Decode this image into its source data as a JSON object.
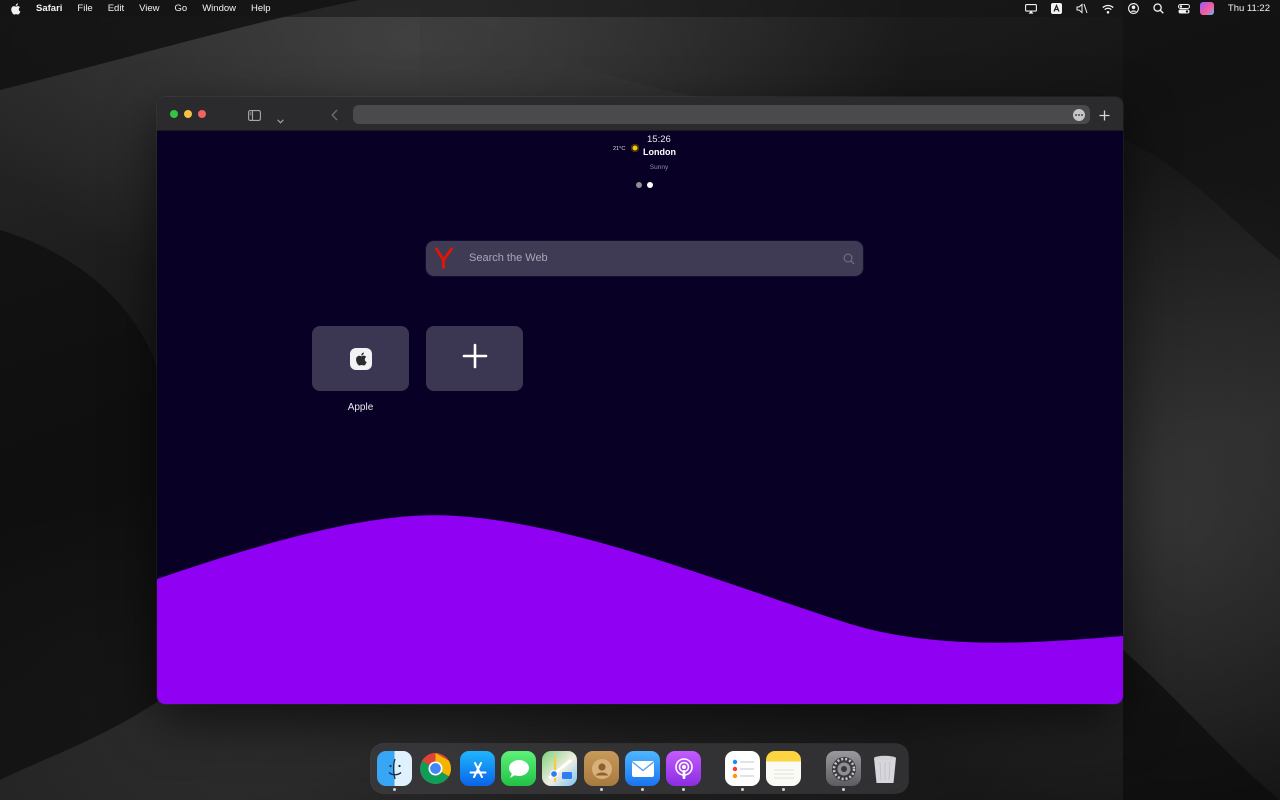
{
  "menubar": {
    "app_name": "Safari",
    "menus": [
      "File",
      "Edit",
      "View",
      "Go",
      "Window",
      "Help"
    ],
    "clock": "Thu 11:22"
  },
  "browser": {
    "address_value": "",
    "weather": {
      "time": "15:26",
      "temperature": "21°C",
      "city": "London",
      "condition": "Sunny"
    },
    "search": {
      "placeholder": "Search the Web"
    },
    "favorites": [
      {
        "label": "Apple"
      }
    ]
  },
  "dock": {
    "apps": [
      "finder",
      "chrome",
      "app-store",
      "messages",
      "maps",
      "contacts",
      "mail",
      "podcasts",
      "reminders",
      "notes",
      "system-settings",
      "trash"
    ]
  },
  "colors": {
    "page_background": "#090125",
    "wave": "#9000f2",
    "search_box": "#403b55",
    "yandex_red": "#e61400"
  }
}
